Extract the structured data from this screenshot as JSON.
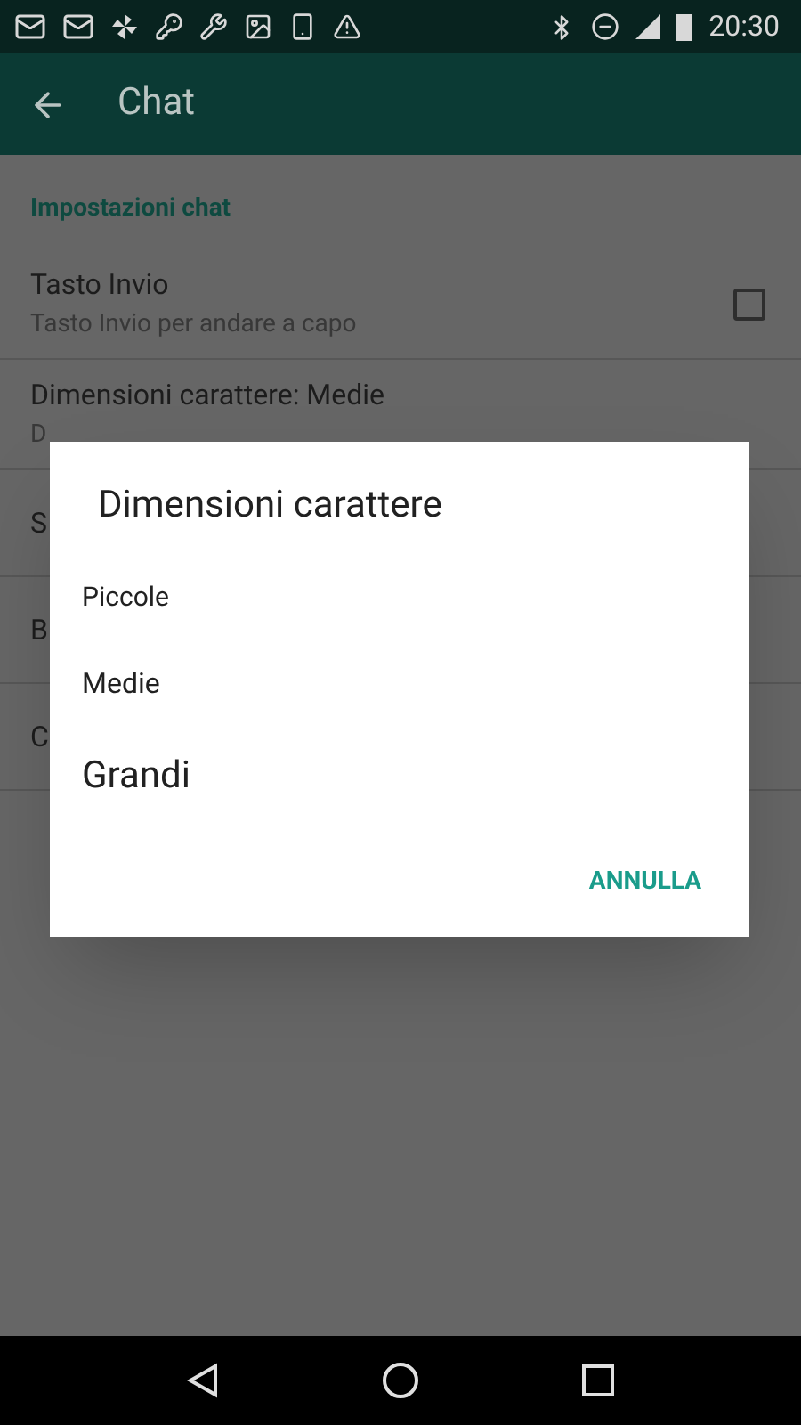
{
  "status_bar": {
    "time": "20:30"
  },
  "app_bar": {
    "title": "Chat"
  },
  "settings": {
    "section": "Impostazioni chat",
    "rows": [
      {
        "title": "Tasto Invio",
        "subtitle": "Tasto Invio per andare a capo",
        "kind": "checkbox",
        "checked": false
      },
      {
        "title": "Dimensioni carattere: Medie",
        "subtitle": "D",
        "kind": "plain"
      },
      {
        "title": "S",
        "kind": "plain"
      },
      {
        "title": "B",
        "kind": "plain"
      },
      {
        "title": "C",
        "kind": "plain"
      }
    ]
  },
  "dialog": {
    "title": "Dimensioni carattere",
    "options": [
      {
        "label": "Piccole",
        "kind": "small"
      },
      {
        "label": "Medie",
        "kind": "medium"
      },
      {
        "label": "Grandi",
        "kind": "large"
      }
    ],
    "buttons": [
      "ANNULLA"
    ]
  }
}
